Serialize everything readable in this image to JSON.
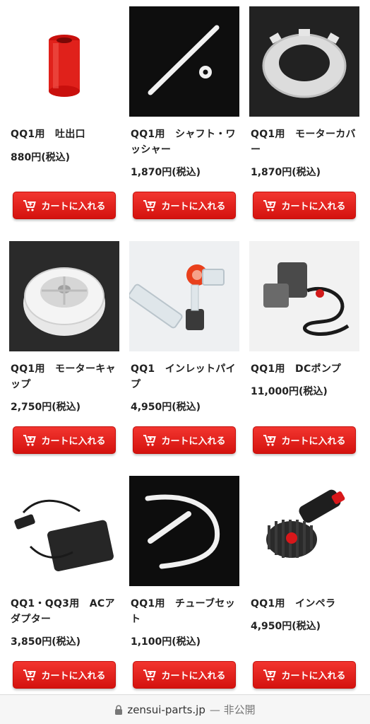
{
  "cart_button_label": "カートに入れる",
  "products": [
    {
      "name": "QQ1用　吐出口",
      "price": "880円(税込)",
      "image": "red-outlet-tube"
    },
    {
      "name": "QQ1用　シャフト・ワッシャー",
      "price": "1,870円(税込)",
      "image": "shaft-washer"
    },
    {
      "name": "QQ1用　モーターカバー",
      "price": "1,870円(税込)",
      "image": "motor-cover-ring"
    },
    {
      "name": "QQ1用　モーターキャップ",
      "price": "2,750円(税込)",
      "image": "motor-cap"
    },
    {
      "name": "QQ1　インレットパイプ",
      "price": "4,950円(税込)",
      "image": "inlet-pipe"
    },
    {
      "name": "QQ1用　DCポンプ",
      "price": "11,000円(税込)",
      "image": "dc-pump"
    },
    {
      "name": "QQ1・QQ3用　ACアダプター",
      "price": "3,850円(税込)",
      "image": "ac-adapter"
    },
    {
      "name": "QQ1用　チューブセット",
      "price": "1,100円(税込)",
      "image": "tube-set"
    },
    {
      "name": "QQ1用　インペラ",
      "price": "4,950円(税込)",
      "image": "impeller"
    }
  ],
  "browser": {
    "domain": "zensui-parts.jp",
    "status": "— 非公開"
  },
  "colors": {
    "cart_button": "#e21b16",
    "dark_photo_bg": "#111111"
  }
}
